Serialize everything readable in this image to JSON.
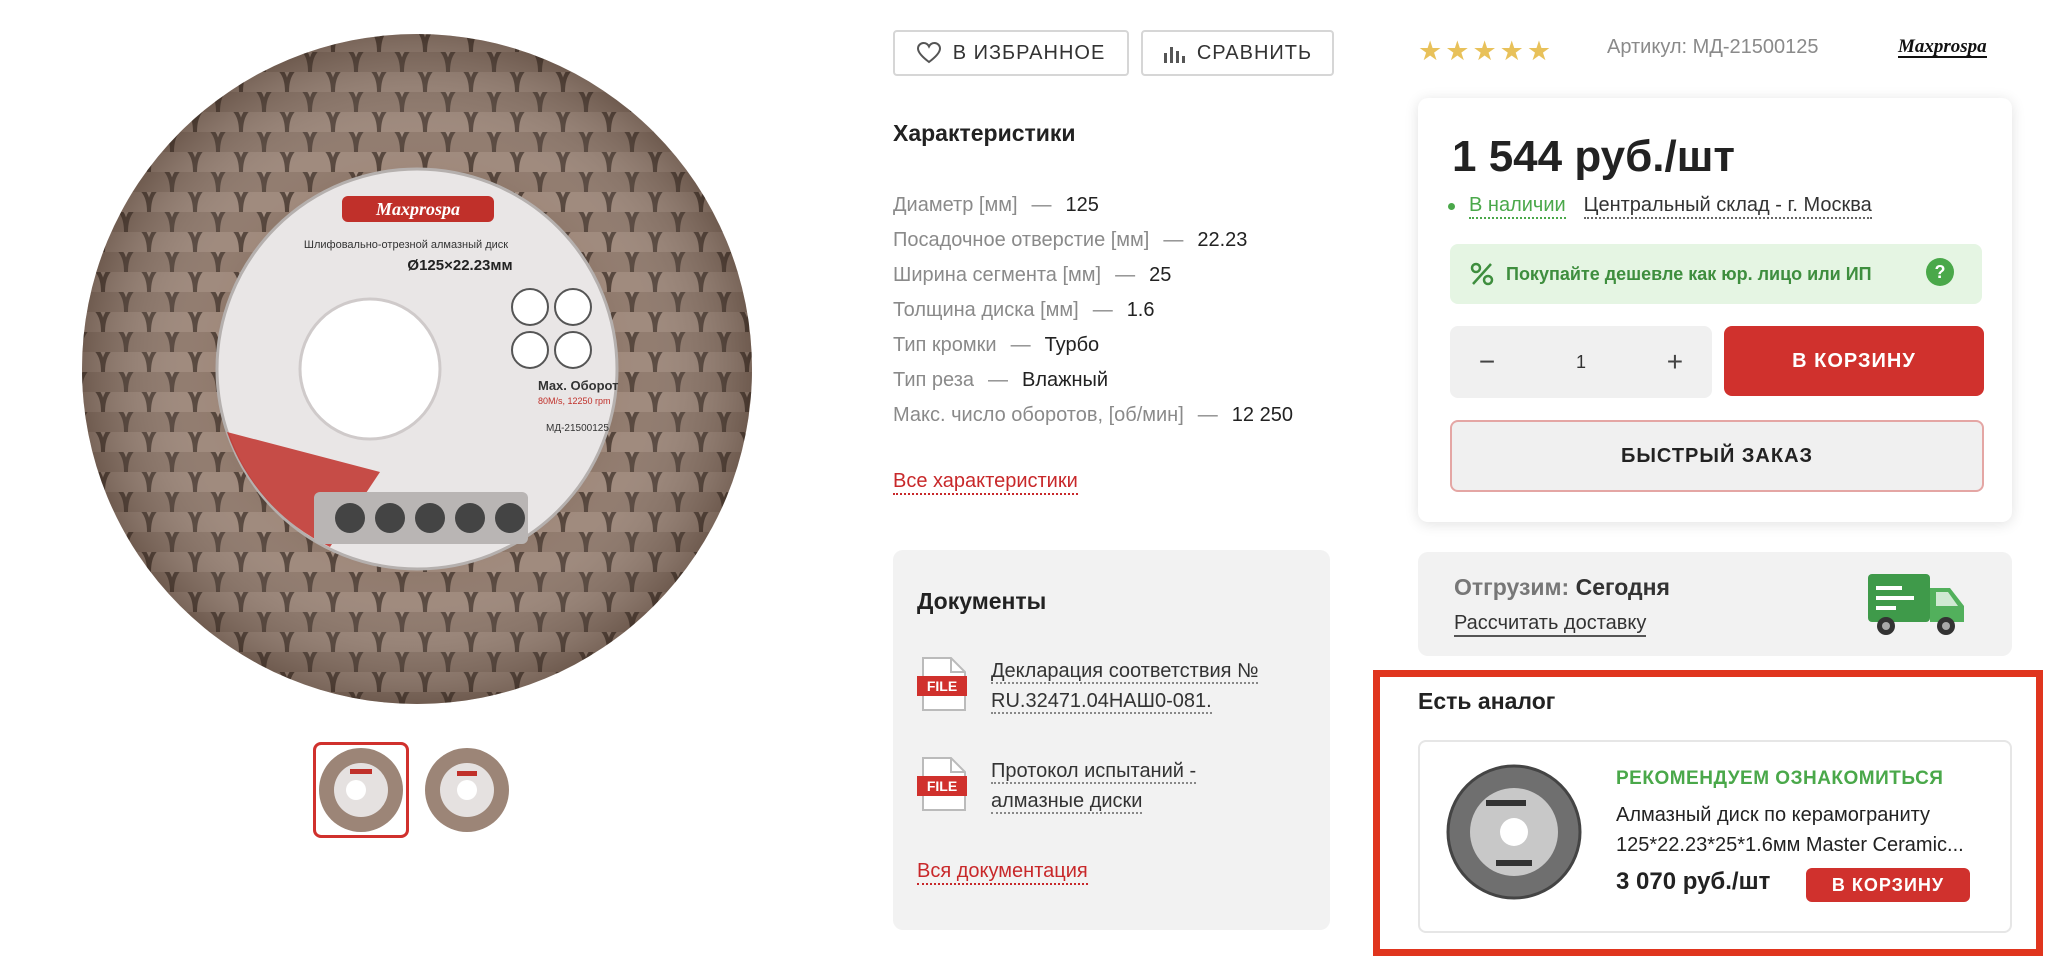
{
  "gallery": {
    "main_image_alt": "Шлифовально-отрезной алмазный диск",
    "product_label": {
      "brand": "Maxprospa",
      "title": "Шлифовально-отрезной алмазный диск",
      "size": "Ø125×22.23мм",
      "max_rpm_title": "Max. Оборот",
      "max_rpm_value": "80M/s, 12250 rpm",
      "article": "МД-21500125"
    },
    "thumbnails": [
      {
        "label": "thumb-1",
        "active": true
      },
      {
        "label": "thumb-2",
        "active": false
      }
    ]
  },
  "actions": {
    "favorite_label": "В ИЗБРАННОЕ",
    "compare_label": "СРАВНИТЬ"
  },
  "specs": {
    "title": "Характеристики",
    "items": [
      {
        "label": "Диаметр [мм]",
        "value": "125"
      },
      {
        "label": "Посадочное отверстие [мм]",
        "value": "22.23"
      },
      {
        "label": "Ширина сегмента [мм]",
        "value": "25"
      },
      {
        "label": "Толщина диска [мм]",
        "value": "1.6"
      },
      {
        "label": "Тип кромки",
        "value": "Турбо"
      },
      {
        "label": "Тип реза",
        "value": "Влажный"
      },
      {
        "label": "Макс. число оборотов, [об/мин]",
        "value": "12 250"
      }
    ],
    "dash": "—",
    "all_link": "Все характеристики"
  },
  "documents": {
    "title": "Документы",
    "file_badge": "FILE",
    "items": [
      {
        "line1": "Декларация соответствия №",
        "line2": "RU.32471.04НАШ0-081."
      },
      {
        "line1": "Протокол испытаний -",
        "line2": "алмазные диски"
      }
    ],
    "all_link": "Вся документация"
  },
  "product": {
    "rating_stars": 5,
    "star_glyph": "★",
    "article": "Артикул: МД-21500125",
    "brand": "Maxprospa",
    "price": "1 544 руб./шт",
    "stock": "В наличии",
    "warehouse": "Центральный склад - г. Москва",
    "promo": "Покупайте дешевле как юр. лицо или ИП",
    "promo_help": "?",
    "quantity": "1",
    "minus": "−",
    "plus": "+",
    "cart_label": "В КОРЗИНУ",
    "quick_order_label": "БЫСТРЫЙ ЗАКАЗ"
  },
  "shipping": {
    "label": "Отгрузим:",
    "value": "Сегодня",
    "calc_link": "Рассчитать доставку"
  },
  "analog": {
    "title": "Есть аналог",
    "recommend": "РЕКОМЕНДУЕМ ОЗНАКОМИТЬСЯ",
    "name_line1": "Алмазный диск по керамограниту",
    "name_line2": "125*22.23*25*1.6мм Master Ceramic...",
    "price": "3 070 руб./шт",
    "cart_label": "В КОРЗИНУ"
  },
  "colors": {
    "accent_red": "#d0312d",
    "highlight_frame": "#e0351e",
    "stock_green": "#4aa84a",
    "promo_bg": "#e5f5e3",
    "star_gold": "#e8c15a"
  }
}
